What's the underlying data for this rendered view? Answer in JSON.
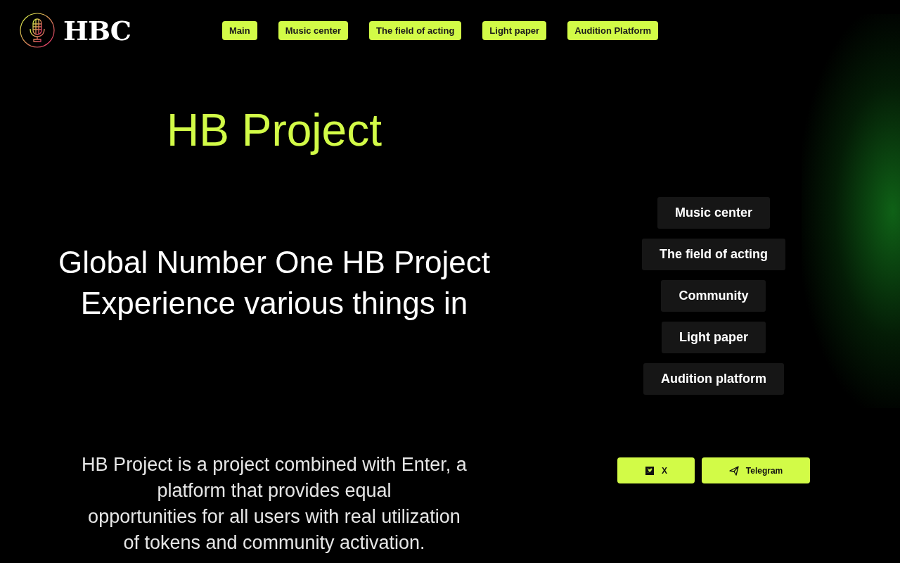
{
  "logo": {
    "text": "HBC"
  },
  "nav": [
    {
      "label": "Main"
    },
    {
      "label": "Music center"
    },
    {
      "label": "The field of acting"
    },
    {
      "label": "Light paper"
    },
    {
      "label": "Audition Platform"
    }
  ],
  "hero": {
    "title": "HB Project",
    "headline": "Global Number One HB Project\nExperience various things in",
    "description": "HB Project is a project combined with Enter, a\nplatform that provides equal\nopportunities for all users with real utilization\nof tokens and community activation."
  },
  "menu": [
    {
      "label": "Music center"
    },
    {
      "label": "The field of acting"
    },
    {
      "label": "Community"
    },
    {
      "label": "Light paper"
    },
    {
      "label": "Audition platform"
    }
  ],
  "social": [
    {
      "kind": "x",
      "label": "X"
    },
    {
      "kind": "telegram",
      "label": "Telegram"
    }
  ]
}
